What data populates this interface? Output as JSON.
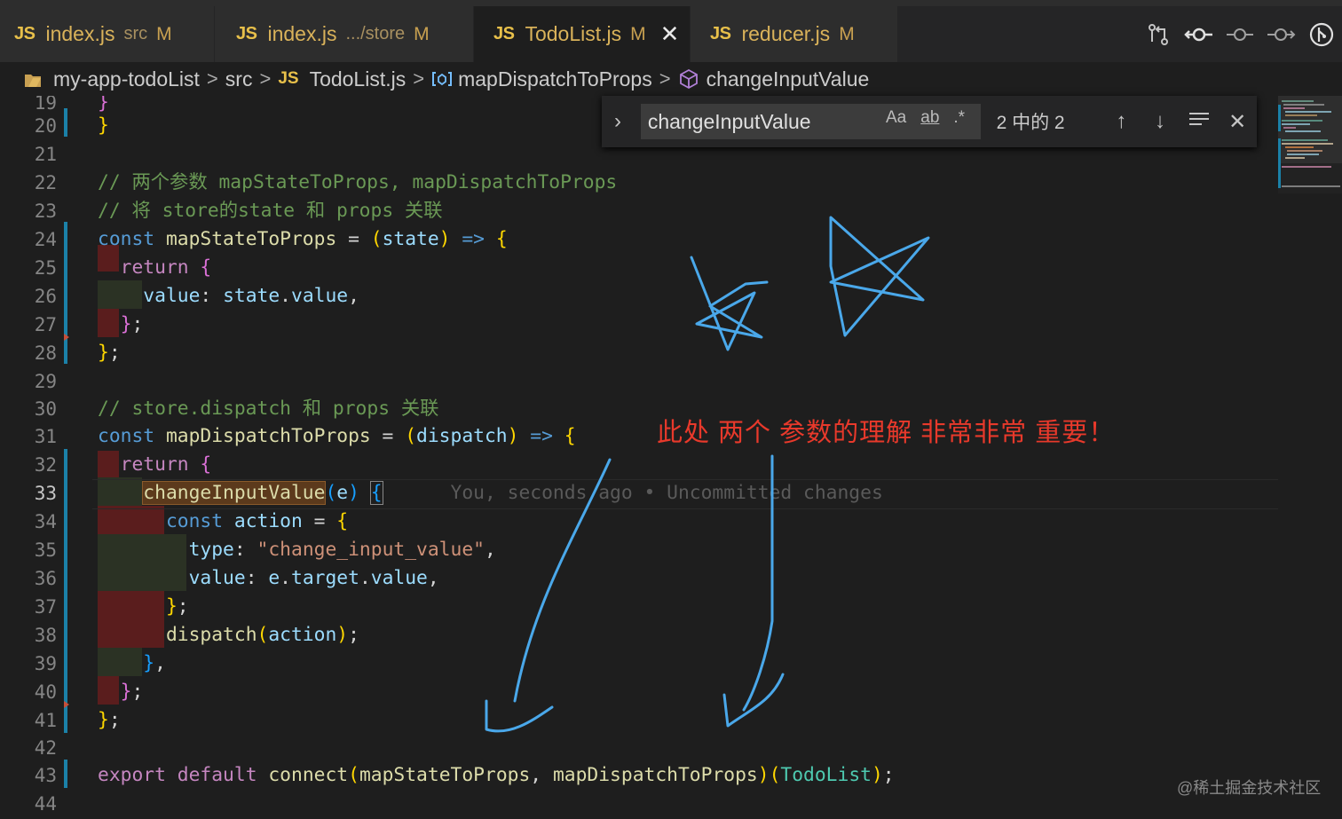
{
  "tabs": [
    {
      "lang": "JS",
      "name": "index.js",
      "dir": "src",
      "status": "M"
    },
    {
      "lang": "JS",
      "name": "index.js",
      "dir": ".../store",
      "status": "M"
    },
    {
      "lang": "JS",
      "name": "TodoList.js",
      "dir": "",
      "status": "M",
      "close": "✕"
    },
    {
      "lang": "JS",
      "name": "reducer.js",
      "dir": "",
      "status": "M"
    }
  ],
  "toolbar_icons": [
    "compare-changes-icon",
    "git-commit-icon",
    "previous-change-icon",
    "next-change-icon",
    "git-lens-icon"
  ],
  "breadcrumb": {
    "folder": "my-app-todoList",
    "dir": "src",
    "file_lang": "JS",
    "file": "TodoList.js",
    "symbol1": "mapDispatchToProps",
    "symbol2": "changeInputValue"
  },
  "find": {
    "value": "changeInputValue",
    "opt_case": "Aa",
    "opt_word": "ab",
    "opt_regex": ".*",
    "count": "2 中的 2",
    "prev": "↑",
    "next": "↓",
    "close": "✕"
  },
  "code": {
    "line_numbers": [
      "19",
      "20",
      "21",
      "22",
      "23",
      "24",
      "25",
      "26",
      "27",
      "28",
      "29",
      "30",
      "31",
      "32",
      "33",
      "34",
      "35",
      "36",
      "37",
      "38",
      "39",
      "40",
      "41",
      "42",
      "43",
      "44"
    ],
    "l20": "}",
    "l22": "// 两个参数 mapStateToProps, mapDispatchToProps",
    "l23": "// 将 store的state 和 props 关联",
    "l24_kw": "const",
    "l24_name": "mapStateToProps",
    "l24_eq": " = ",
    "l24_param": "state",
    "l24_arrow": "=>",
    "l25_kw": "return",
    "l26_prop": "value",
    "l26_val1": "state",
    "l26_val2": "value",
    "l30": "// store.dispatch 和 props 关联",
    "l31_kw": "const",
    "l31_name": "mapDispatchToProps",
    "l31_param": "dispatch",
    "l32_kw": "return",
    "l33_name": "changeInputValue",
    "l33_param": "e",
    "blame": "You, seconds ago • Uncommitted changes",
    "l34_kw": "const",
    "l34_name": "action",
    "l35_prop": "type",
    "l35_str": "\"change_input_value\"",
    "l36_prop": "value",
    "l36_e": "e",
    "l36_t": "target",
    "l36_v": "value",
    "l38_fn": "dispatch",
    "l38_arg": "action",
    "l43_kw1": "export",
    "l43_kw2": "default",
    "l43_fn": "connect",
    "l43_a1": "mapStateToProps",
    "l43_a2": "mapDispatchToProps",
    "l43_type": "TodoList"
  },
  "annotation": "此处 两个 参数的理解 非常非常 重要！",
  "watermark": "@稀土掘金技术社区",
  "colors": {
    "annotation": "#e8392b",
    "pen": "#4aa8ea",
    "accent": "#1b81a8"
  }
}
